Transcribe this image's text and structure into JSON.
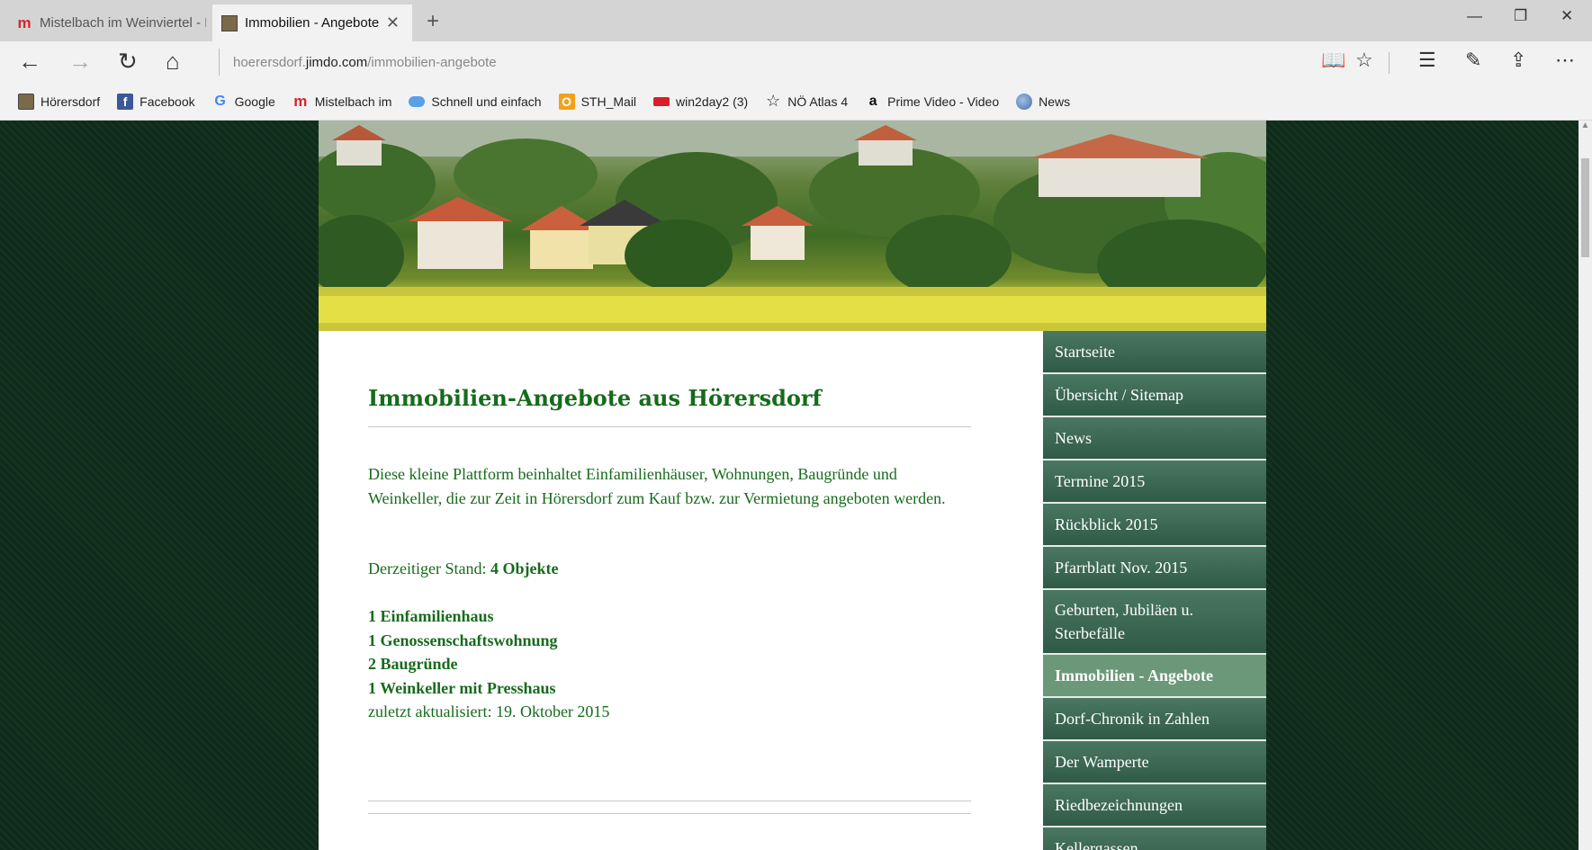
{
  "browser": {
    "tabs": [
      {
        "title": "Mistelbach im Weinviertel - I",
        "favicon": "m"
      },
      {
        "title": "Immobilien - Angebote",
        "close": "✕",
        "favicon": "house-photo"
      }
    ],
    "new_tab": "+",
    "window_controls": {
      "minimize": "—",
      "restore": "❐",
      "close": "✕"
    },
    "nav": {
      "back": "←",
      "forward": "→",
      "refresh": "↻",
      "home": "⌂"
    },
    "url": {
      "prefix": "hoerersdorf.",
      "domain": "jimdo.com",
      "path": "/immobilien-angebote"
    },
    "toolbar": {
      "reading_view": "📖",
      "favorite": "☆",
      "hub": "☰",
      "notes": "✎",
      "share": "⇪",
      "more": "⋯"
    },
    "favorites": [
      {
        "label": "Hörersdorf",
        "icon": "house-photo"
      },
      {
        "label": "Facebook",
        "icon": "f"
      },
      {
        "label": "Google",
        "icon": "G"
      },
      {
        "label": "Mistelbach im",
        "icon": "m"
      },
      {
        "label": "Schnell und einfach",
        "icon": "chat"
      },
      {
        "label": "STH_Mail",
        "icon": "O"
      },
      {
        "label": "win2day2 (3)",
        "icon": "flag"
      },
      {
        "label": "NÖ Atlas 4",
        "icon": "☆"
      },
      {
        "label": "Prime Video - Video",
        "icon": "a"
      },
      {
        "label": "News",
        "icon": "globe"
      }
    ]
  },
  "page": {
    "heading": "Immobilien-Angebote aus Hörersdorf",
    "intro": "Diese kleine Plattform beinhaltet Einfamilienhäuser, Wohnungen, Baugründe und Weinkeller, die zur Zeit in Hörersdorf zum Kauf bzw. zur Vermietung angeboten werden.",
    "status_label": "Derzeitiger Stand:",
    "status_value": "4 Objekte",
    "items": [
      "1 Einfamilienhaus",
      "1 Genossenschaftswohnung",
      "2 Baugründe",
      "1 Weinkeller mit Presshaus"
    ],
    "updated": "zuletzt aktualisiert:  19. Oktober 2015"
  },
  "sidebar_nav": [
    {
      "label": "Startseite"
    },
    {
      "label": "Übersicht / Sitemap"
    },
    {
      "label": "News"
    },
    {
      "label": "Termine 2015"
    },
    {
      "label": "Rückblick 2015"
    },
    {
      "label": "Pfarrblatt Nov. 2015"
    },
    {
      "label": "Geburten, Jubiläen u. Sterbefälle"
    },
    {
      "label": "Immobilien - Angebote",
      "active": true
    },
    {
      "label": "Dorf-Chronik in Zahlen"
    },
    {
      "label": "Der Wamperte"
    },
    {
      "label": "Riedbezeichnungen"
    },
    {
      "label": "Kellergassen"
    }
  ],
  "colors": {
    "text_green": "#176b1c",
    "nav_bg": "#2f5a47",
    "nav_active": "#6b9878",
    "page_bg": "#0f2a1b"
  }
}
